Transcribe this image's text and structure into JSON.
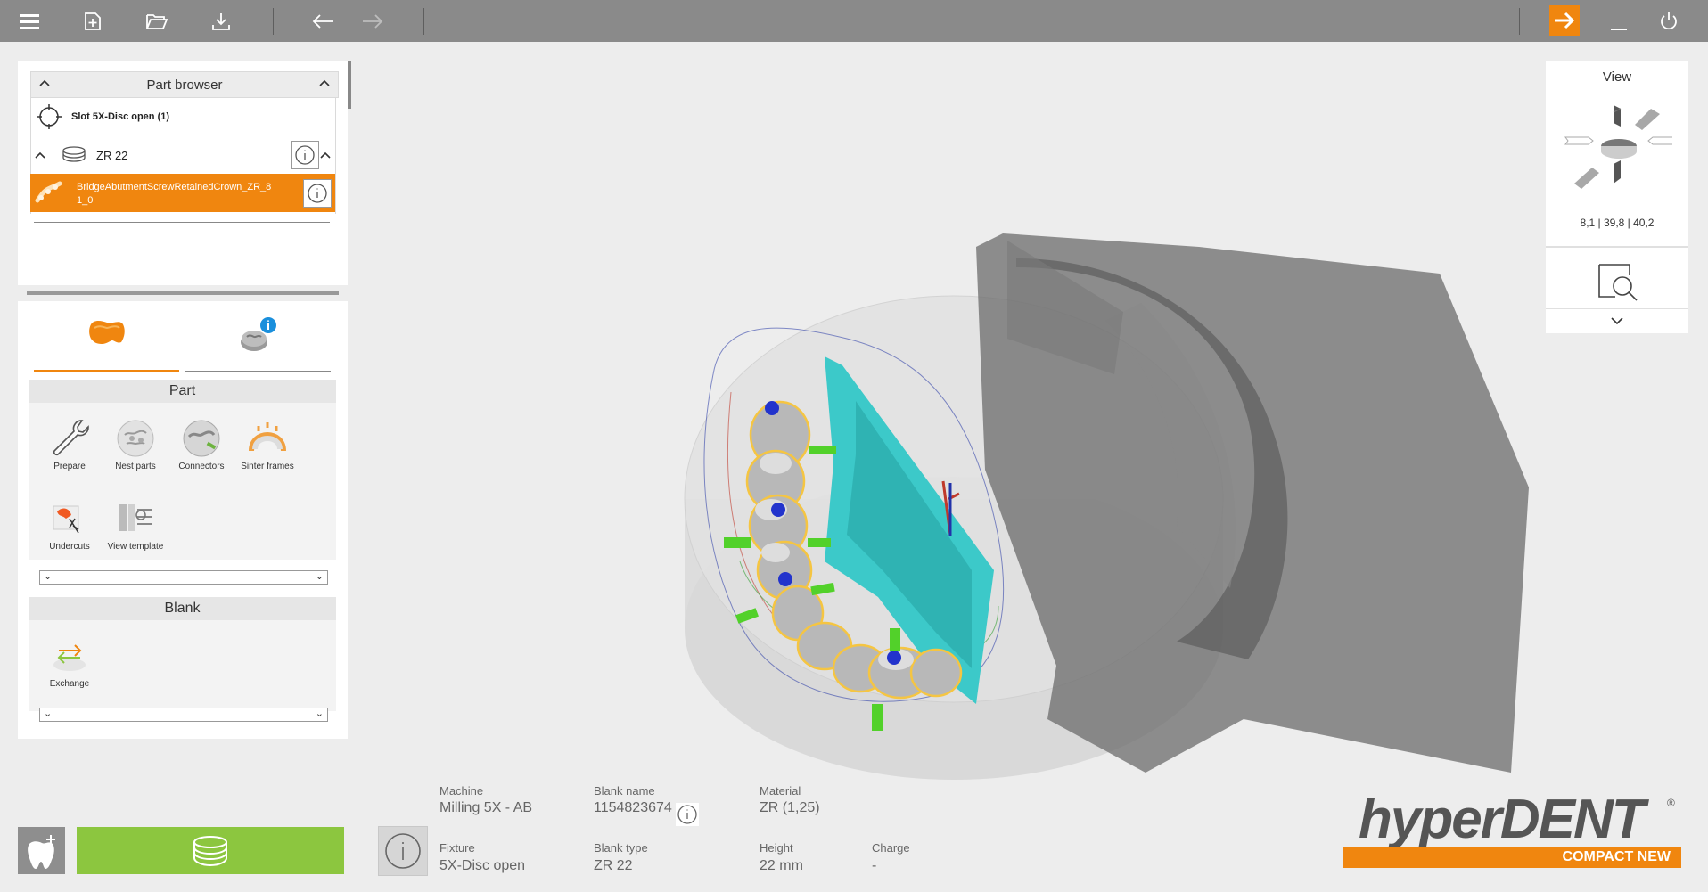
{
  "toolbar": {
    "icons": [
      "menu-icon",
      "new-file-icon",
      "open-folder-icon",
      "download-icon",
      "undo-icon",
      "redo-icon",
      "next-icon",
      "minimize-icon",
      "power-icon"
    ]
  },
  "part_browser": {
    "title": "Part browser",
    "slot_label": "Slot  5X-Disc open (1)",
    "blank_label": "ZR 22",
    "selected_part_line1": "BridgeAbutmentScrewRetainedCrown_ZR_8",
    "selected_part_line2": "1_0"
  },
  "part_section": {
    "title": "Part",
    "tools": [
      {
        "label": "Prepare"
      },
      {
        "label": "Nest parts"
      },
      {
        "label": "Connectors"
      },
      {
        "label": "Sinter frames"
      },
      {
        "label": "Undercuts"
      },
      {
        "label": "View template"
      }
    ]
  },
  "blank_section": {
    "title": "Blank",
    "tools": [
      {
        "label": "Exchange"
      }
    ]
  },
  "view_panel": {
    "title": "View",
    "coords": "8,1  | 39,8 | 40,2"
  },
  "info": {
    "machine_label": "Machine",
    "machine_value": "Milling 5X - AB",
    "blank_name_label": "Blank name",
    "blank_name_value": "1154823674",
    "material_label": "Material",
    "material_value": "ZR (1,25)",
    "fixture_label": "Fixture",
    "fixture_value": "5X-Disc open",
    "blank_type_label": "Blank type",
    "blank_type_value": "ZR 22",
    "height_label": "Height",
    "height_value": "22 mm",
    "charge_label": "Charge",
    "charge_value": "-"
  },
  "logo": {
    "brand": "hyperDENT",
    "reg": "®",
    "edition": "COMPACT NEW"
  },
  "colors": {
    "toolbar": "#8a8a8a",
    "accent": "#f0860f",
    "green": "#8cc63f",
    "background": "#ededed"
  }
}
